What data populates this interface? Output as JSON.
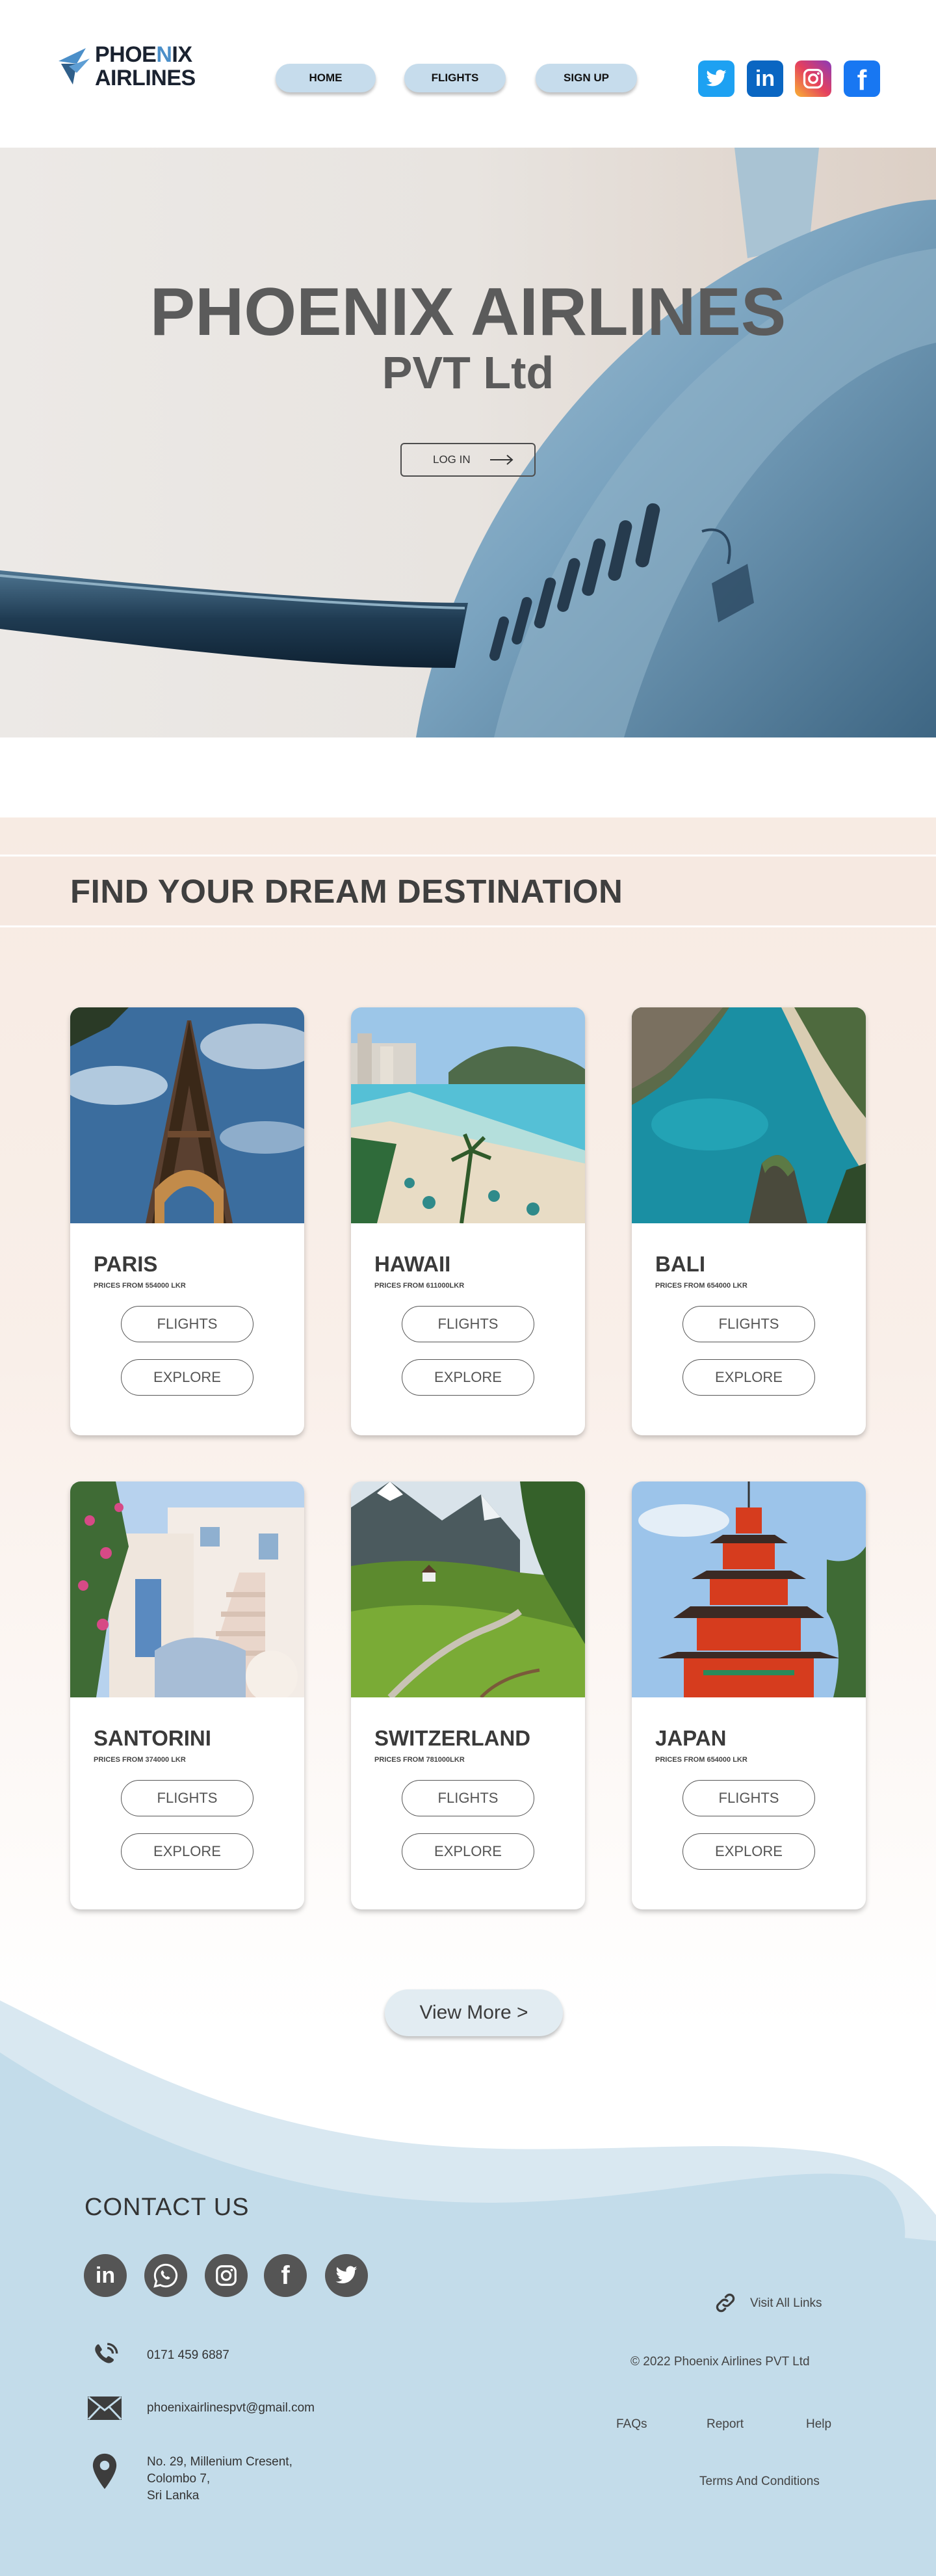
{
  "header": {
    "logo_top": "PHOE",
    "logo_accent": "N",
    "logo_top_rest": "IX",
    "logo_bottom": "AIRLINES",
    "nav": [
      {
        "label": "HOME"
      },
      {
        "label": "FLIGHTS"
      },
      {
        "label": "SIGN UP"
      }
    ],
    "social": [
      {
        "icon": "twitter-icon",
        "color": "#1da1f2"
      },
      {
        "icon": "linkedin-icon",
        "color": "#0a66c2"
      },
      {
        "icon": "instagram-icon",
        "color": "#e4405f"
      },
      {
        "icon": "facebook-icon",
        "color": "#1877f2"
      }
    ]
  },
  "hero": {
    "title": "PHOENIX AIRLINES",
    "subtitle": "PVT Ltd",
    "login_label": "LOG IN"
  },
  "destinations": {
    "heading": "FIND YOUR DREAM DESTINATION",
    "cards": [
      {
        "name": "PARIS",
        "price": "PRICES FROM 554000 LKR",
        "flights": "FLIGHTS",
        "explore": "EXPLORE"
      },
      {
        "name": "HAWAII",
        "price": "PRICES FROM 611000LKR",
        "flights": "FLIGHTS",
        "explore": "EXPLORE"
      },
      {
        "name": "BALI",
        "price": "PRICES FROM 654000 LKR",
        "flights": "FLIGHTS",
        "explore": "EXPLORE"
      },
      {
        "name": "SANTORINI",
        "price": "PRICES FROM 374000 LKR",
        "flights": "FLIGHTS",
        "explore": "EXPLORE"
      },
      {
        "name": "SWITZERLAND",
        "price": "PRICES FROM 781000LKR",
        "flights": "FLIGHTS",
        "explore": "EXPLORE"
      },
      {
        "name": "JAPAN",
        "price": "PRICES FROM 654000 LKR",
        "flights": "FLIGHTS",
        "explore": "EXPLORE"
      }
    ],
    "view_more": "View More  >"
  },
  "footer": {
    "contact_title": "CONTACT US",
    "social": [
      "linkedin-icon",
      "whatsapp-icon",
      "instagram-icon",
      "facebook-icon",
      "twitter-icon"
    ],
    "phone": "0171 459 6887",
    "email": "phoenixairlinespvt@gmail.com",
    "address_line1": "No. 29, Millenium Cresent,",
    "address_line2": "Colombo 7,",
    "address_line3": "Sri Lanka",
    "visit_links": "Visit All Links",
    "copyright": "© 2022 Phoenix Airlines PVT Ltd",
    "links": [
      "FAQs",
      "Report",
      "Help"
    ],
    "terms": "Terms And Conditions",
    "bg_color": "#c3dcea"
  }
}
